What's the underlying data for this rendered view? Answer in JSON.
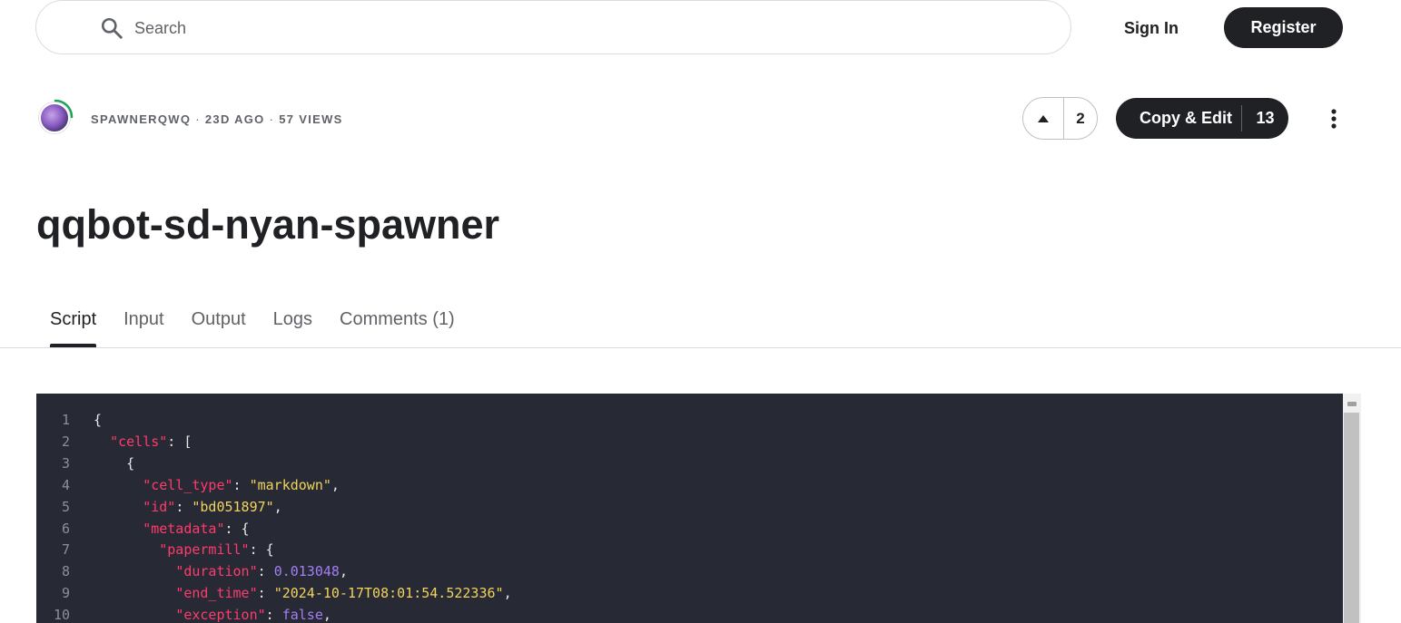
{
  "header": {
    "search": {
      "placeholder": "Search",
      "icon": "search-icon"
    },
    "sign_in_label": "Sign In",
    "register_label": "Register"
  },
  "meta": {
    "author": "SPAWNERQWQ",
    "age": "23D AGO",
    "views": "57 VIEWS",
    "separator": "·"
  },
  "actions": {
    "upvote_icon": "caret-up-icon",
    "vote_count": "2",
    "copy_edit_label": "Copy & Edit",
    "copy_edit_count": "13",
    "more_icon": "kebab-menu-icon"
  },
  "page_title": "qqbot-sd-nyan-spawner",
  "tabs": [
    {
      "label": "Script",
      "active": true
    },
    {
      "label": "Input",
      "active": false
    },
    {
      "label": "Output",
      "active": false
    },
    {
      "label": "Logs",
      "active": false
    },
    {
      "label": "Comments (1)",
      "active": false
    }
  ],
  "code": {
    "lines": [
      {
        "num": "1",
        "tokens": [
          [
            "p",
            "{"
          ]
        ]
      },
      {
        "num": "2",
        "tokens": [
          [
            "p",
            "  "
          ],
          [
            "k",
            "\"cells\""
          ],
          [
            "p",
            ": ["
          ]
        ]
      },
      {
        "num": "3",
        "tokens": [
          [
            "p",
            "    {"
          ]
        ]
      },
      {
        "num": "4",
        "tokens": [
          [
            "p",
            "      "
          ],
          [
            "k",
            "\"cell_type\""
          ],
          [
            "p",
            ": "
          ],
          [
            "s",
            "\"markdown\""
          ],
          [
            "p",
            ","
          ]
        ]
      },
      {
        "num": "5",
        "tokens": [
          [
            "p",
            "      "
          ],
          [
            "k",
            "\"id\""
          ],
          [
            "p",
            ": "
          ],
          [
            "s",
            "\"bd051897\""
          ],
          [
            "p",
            ","
          ]
        ]
      },
      {
        "num": "6",
        "tokens": [
          [
            "p",
            "      "
          ],
          [
            "k",
            "\"metadata\""
          ],
          [
            "p",
            ": {"
          ]
        ]
      },
      {
        "num": "7",
        "tokens": [
          [
            "p",
            "        "
          ],
          [
            "k",
            "\"papermill\""
          ],
          [
            "p",
            ": {"
          ]
        ]
      },
      {
        "num": "8",
        "tokens": [
          [
            "p",
            "          "
          ],
          [
            "k",
            "\"duration\""
          ],
          [
            "p",
            ": "
          ],
          [
            "n",
            "0.013048"
          ],
          [
            "p",
            ","
          ]
        ]
      },
      {
        "num": "9",
        "tokens": [
          [
            "p",
            "          "
          ],
          [
            "k",
            "\"end_time\""
          ],
          [
            "p",
            ": "
          ],
          [
            "s",
            "\"2024-10-17T08:01:54.522336\""
          ],
          [
            "p",
            ","
          ]
        ]
      },
      {
        "num": "10",
        "tokens": [
          [
            "p",
            "          "
          ],
          [
            "k",
            "\"exception\""
          ],
          [
            "p",
            ": "
          ],
          [
            "n",
            "false"
          ],
          [
            "p",
            ","
          ]
        ]
      }
    ],
    "colors": {
      "background": "#272a35",
      "key": "#ff3b6c",
      "string": "#f2d35c",
      "literal": "#a37ef5",
      "punctuation": "#e8e8e8",
      "line_number": "#8b8f9a"
    }
  }
}
